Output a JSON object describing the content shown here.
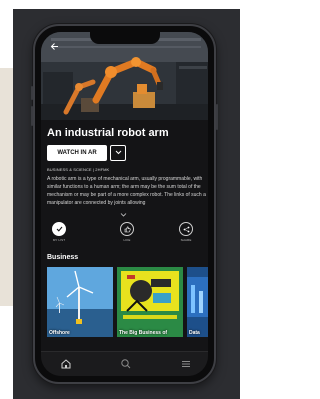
{
  "page": {
    "title": "An industrial robot arm",
    "primary_button": "WATCH IN AR",
    "dropdown_icon": "chevron-down",
    "category": "BUSINESS & SCIENCE | 2HFMK",
    "description": "A robotic arm is a type of mechanical arm, usually programmable, with similar functions to a human arm; the arm may be the sum total of the mechanism or may be part of a more complex robot. The links of such a manipulator are connected by joints allowing"
  },
  "actions": [
    {
      "label": "MY LIST",
      "icon": "check-icon"
    },
    {
      "label": "LIKE",
      "icon": "thumbs-up-icon"
    },
    {
      "label": "SHARE",
      "icon": "share-icon"
    }
  ],
  "section": {
    "title": "Business",
    "cards": [
      {
        "label": "Offshore"
      },
      {
        "label": "The Big Business of"
      },
      {
        "label": "Data"
      }
    ]
  },
  "nav": [
    {
      "icon": "home-icon"
    },
    {
      "icon": "search-icon"
    },
    {
      "icon": "menu-icon"
    }
  ]
}
